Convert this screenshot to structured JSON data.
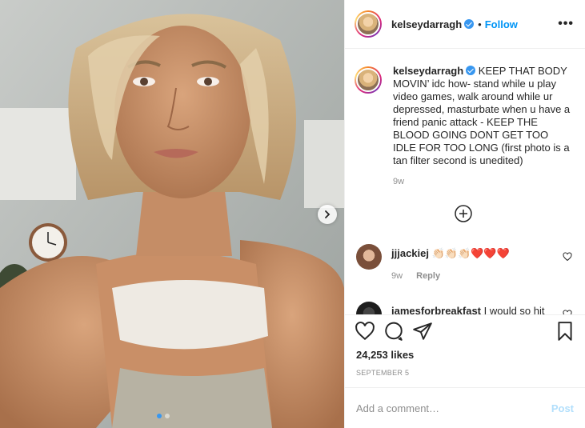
{
  "post": {
    "username": "kelseydarragh",
    "follow_label": "Follow",
    "bullet": "•",
    "more_label": "•••",
    "caption": "KEEP THAT BODY MOVIN’ idc how- stand while u play video games, walk around while ur depressed, masturbate when u have a friend panic attack - KEEP THE BLOOD GOING DONT GET TOO IDLE FOR TOO LONG (first photo is a tan filter second is unedited)",
    "caption_age": "9w",
    "likes": "24,253 likes",
    "date": "SEPTEMBER 5",
    "add_comment_placeholder": "Add a comment…",
    "post_button": "Post"
  },
  "comments": [
    {
      "username": "jjjackiej",
      "text": "👏🏻👏🏻👏🏻❤️❤️❤️",
      "age": "9w",
      "reply_label": "Reply"
    },
    {
      "username": "jamesforbreakfast",
      "text": "I would so hit that 🔥🔥🔥"
    }
  ],
  "icons": {
    "verified": "verified-badge-icon",
    "heart": "heart-icon",
    "comment": "comment-icon",
    "share": "share-icon",
    "save": "bookmark-icon",
    "load_more": "plus-circle-icon",
    "next": "chevron-right-icon"
  },
  "colors": {
    "accent": "#0095f6",
    "verified": "#3897f0",
    "muted": "#8e8e8e",
    "post_disabled": "#b2dffc"
  }
}
